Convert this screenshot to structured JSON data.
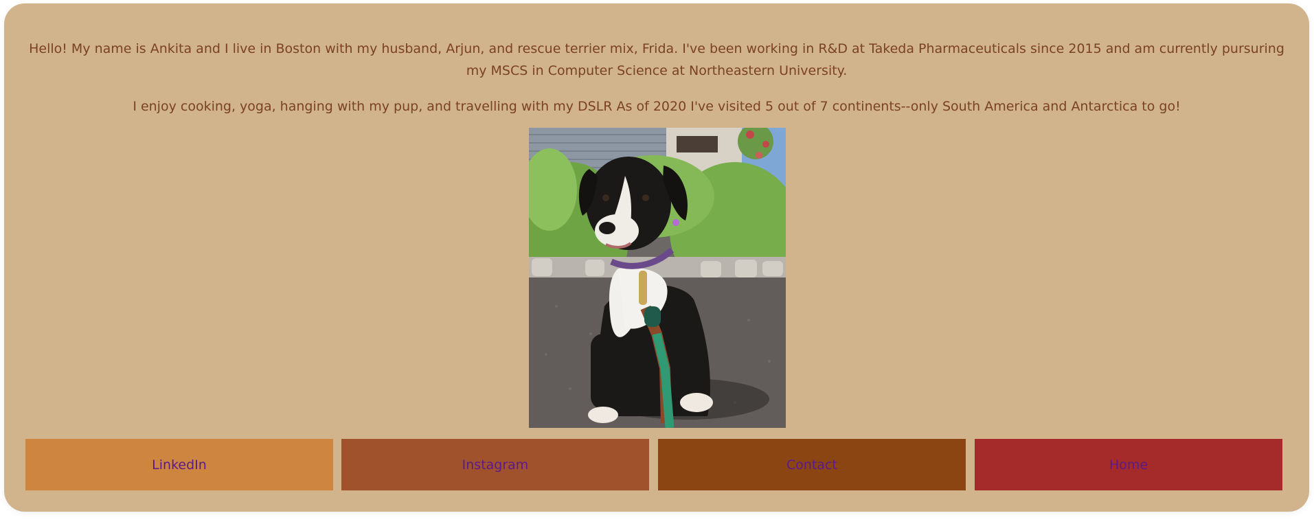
{
  "bio": {
    "paragraph_1": "Hello! My name is Ankita and I live in Boston with my husband, Arjun, and rescue terrier mix, Frida. I've been working in R&D at Takeda Pharmaceuticals since 2015 and am currently pursuring my MSCS in Computer Science at Northeastern University.",
    "paragraph_2": "I enjoy cooking, yoga, hanging with my pup, and travelling with my DSLR As of 2020 I've visited 5 out of 7 continents--only South America and Antarctica to go!"
  },
  "photo": {
    "subject": "black-and-white puppy on green leash sitting on gravel in front of plants"
  },
  "nav": {
    "linkedin": "LinkedIn",
    "instagram": "Instagram",
    "contact": "Contact",
    "home": "Home"
  },
  "colors": {
    "card_bg": "#d2b48c",
    "text": "#7a4220",
    "link_text": "#5b1a8c",
    "linkedin_bg": "#cd853f",
    "instagram_bg": "#a0522d",
    "contact_bg": "#8b4513",
    "home_bg": "#a52a2a"
  }
}
